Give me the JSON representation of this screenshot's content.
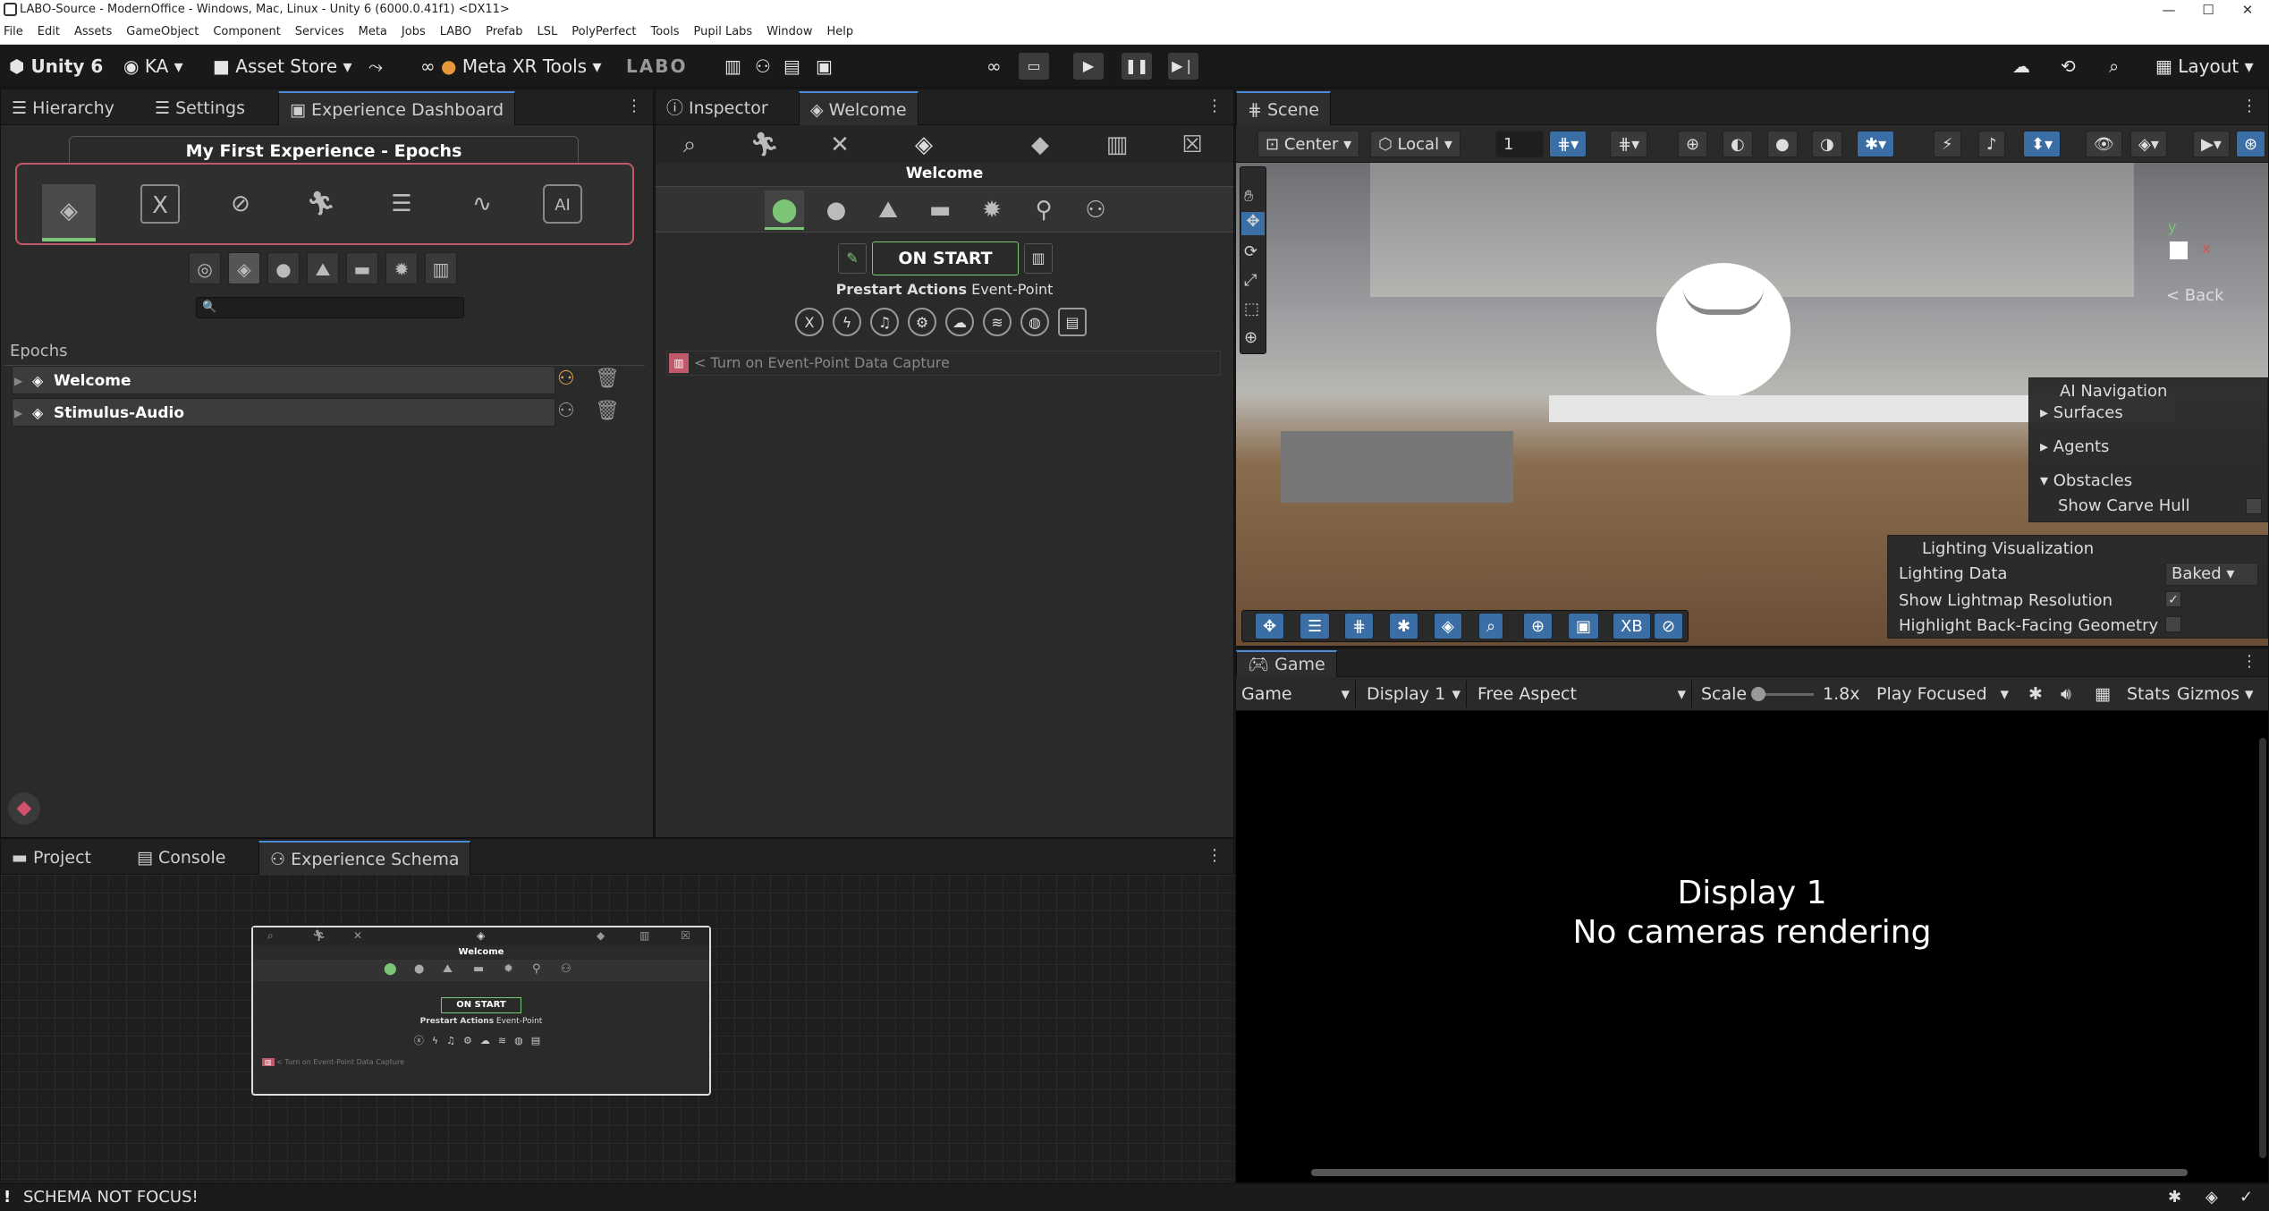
{
  "window": {
    "title": "LABO-Source - ModernOffice - Windows, Mac, Linux - Unity 6 (6000.0.41f1) <DX11>",
    "minimize": "—",
    "maximize": "☐",
    "close": "✕"
  },
  "menu": [
    "File",
    "Edit",
    "Assets",
    "GameObject",
    "Component",
    "Services",
    "Meta",
    "Jobs",
    "LABO",
    "Prefab",
    "LSL",
    "PolyPerfect",
    "Tools",
    "Pupil Labs",
    "Window",
    "Help"
  ],
  "toolbar": {
    "unity_label": "Unity 6",
    "account_label": "KA",
    "asset_store_label": "Asset Store",
    "meta_tools_label": "Meta XR Tools",
    "labo_logo": "LABO",
    "layout_label": "Layout"
  },
  "left_panel": {
    "tabs": [
      "Hierarchy",
      "Settings",
      "Experience Dashboard"
    ],
    "heading": "My First Experience - Epochs",
    "search_placeholder": "🔍",
    "epochs_label": "Epochs",
    "epochs": [
      {
        "name": "Welcome"
      },
      {
        "name": "Stimulus-Audio"
      }
    ]
  },
  "inspector": {
    "tabs": [
      "Inspector",
      "Welcome"
    ],
    "title": "Welcome",
    "on_start": "ON START",
    "prestart_bold": "Prestart Actions",
    "prestart_suffix": " Event-Point",
    "capture_text": "< Turn on Event-Point Data Capture"
  },
  "bottom_left": {
    "tabs": [
      "Project",
      "Console",
      "Experience Schema"
    ],
    "node": {
      "title": "Welcome",
      "on_start": "ON START",
      "prestart_bold": "Prestart Actions",
      "prestart_suffix": " Event-Point",
      "capture_text": "< Turn on Event-Point Data Capture"
    }
  },
  "scene": {
    "tab": "Scene",
    "center_label": "Center",
    "local_label": "Local",
    "grid_value": "1",
    "back_label": "< Back",
    "xb_label": "XB",
    "ai_nav": {
      "title": "AI Navigation",
      "items": [
        "Surfaces",
        "Agents",
        "Obstacles"
      ],
      "carve_label": "Show Carve Hull"
    },
    "lighting": {
      "title": "Lighting Visualization",
      "data_label": "Lighting Data",
      "data_value": "Baked",
      "lightmap_label": "Show Lightmap Resolution",
      "backface_label": "Highlight Back-Facing Geometry"
    }
  },
  "game": {
    "tab": "Game",
    "mode": "Game",
    "display": "Display 1",
    "aspect": "Free Aspect",
    "scale_label": "Scale",
    "scale_value": "1.8x",
    "play_mode": "Play Focused",
    "stats": "Stats",
    "gizmos": "Gizmos",
    "message_line1": "Display 1",
    "message_line2": "No cameras rendering"
  },
  "status": {
    "text": "SCHEMA NOT FOCUS!"
  }
}
